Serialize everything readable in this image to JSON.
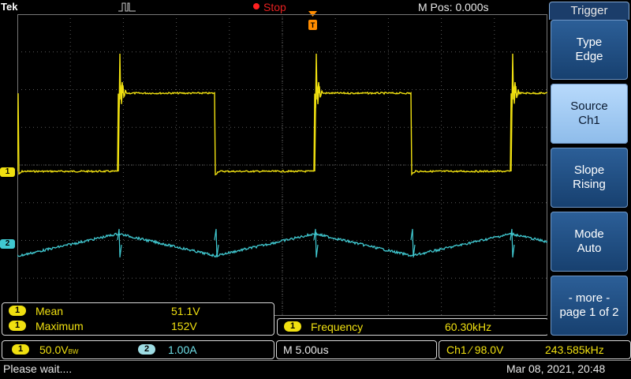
{
  "header": {
    "brand": "Tek",
    "run_state": "Stop",
    "horizontal_position": "M Pos: 0.000s"
  },
  "channel_markers": {
    "ch1": "1",
    "ch2": "2"
  },
  "measurements": [
    {
      "channel": "1",
      "name": "Mean",
      "value": "51.1V"
    },
    {
      "channel": "1",
      "name": "Maximum",
      "value": "152V"
    }
  ],
  "frequency_readout": {
    "channel": "1",
    "name": "Frequency",
    "value": "60.30kHz"
  },
  "vertical": {
    "ch1": {
      "num": "1",
      "scale": "50.0V",
      "suffix": "BW"
    },
    "ch2": {
      "num": "2",
      "scale": "1.00A"
    }
  },
  "timebase": "M 5.00us",
  "trigger_readout": {
    "text": "Ch1 ⁄ 98.0V",
    "frequency": "243.585kHz"
  },
  "status": {
    "message": "Please wait....",
    "datetime": "Mar 08, 2021, 20:48"
  },
  "menu": {
    "title": "Trigger",
    "buttons": [
      {
        "line1": "Type",
        "line2": "Edge"
      },
      {
        "line1": "Source",
        "line2": "Ch1"
      },
      {
        "line1": "Slope",
        "line2": "Rising"
      },
      {
        "line1": "Mode",
        "line2": "Auto"
      },
      {
        "line1": "- more -",
        "line2": "page 1 of 2"
      }
    ]
  },
  "colors": {
    "ch1": "#f0e010",
    "ch2": "#40c8d0",
    "grid": "#5a5a5a",
    "menu": "#2c5f98"
  },
  "icons": [
    "acquisition-pulse-icon",
    "run-stop-dot-icon",
    "trigger-position-icon"
  ]
}
